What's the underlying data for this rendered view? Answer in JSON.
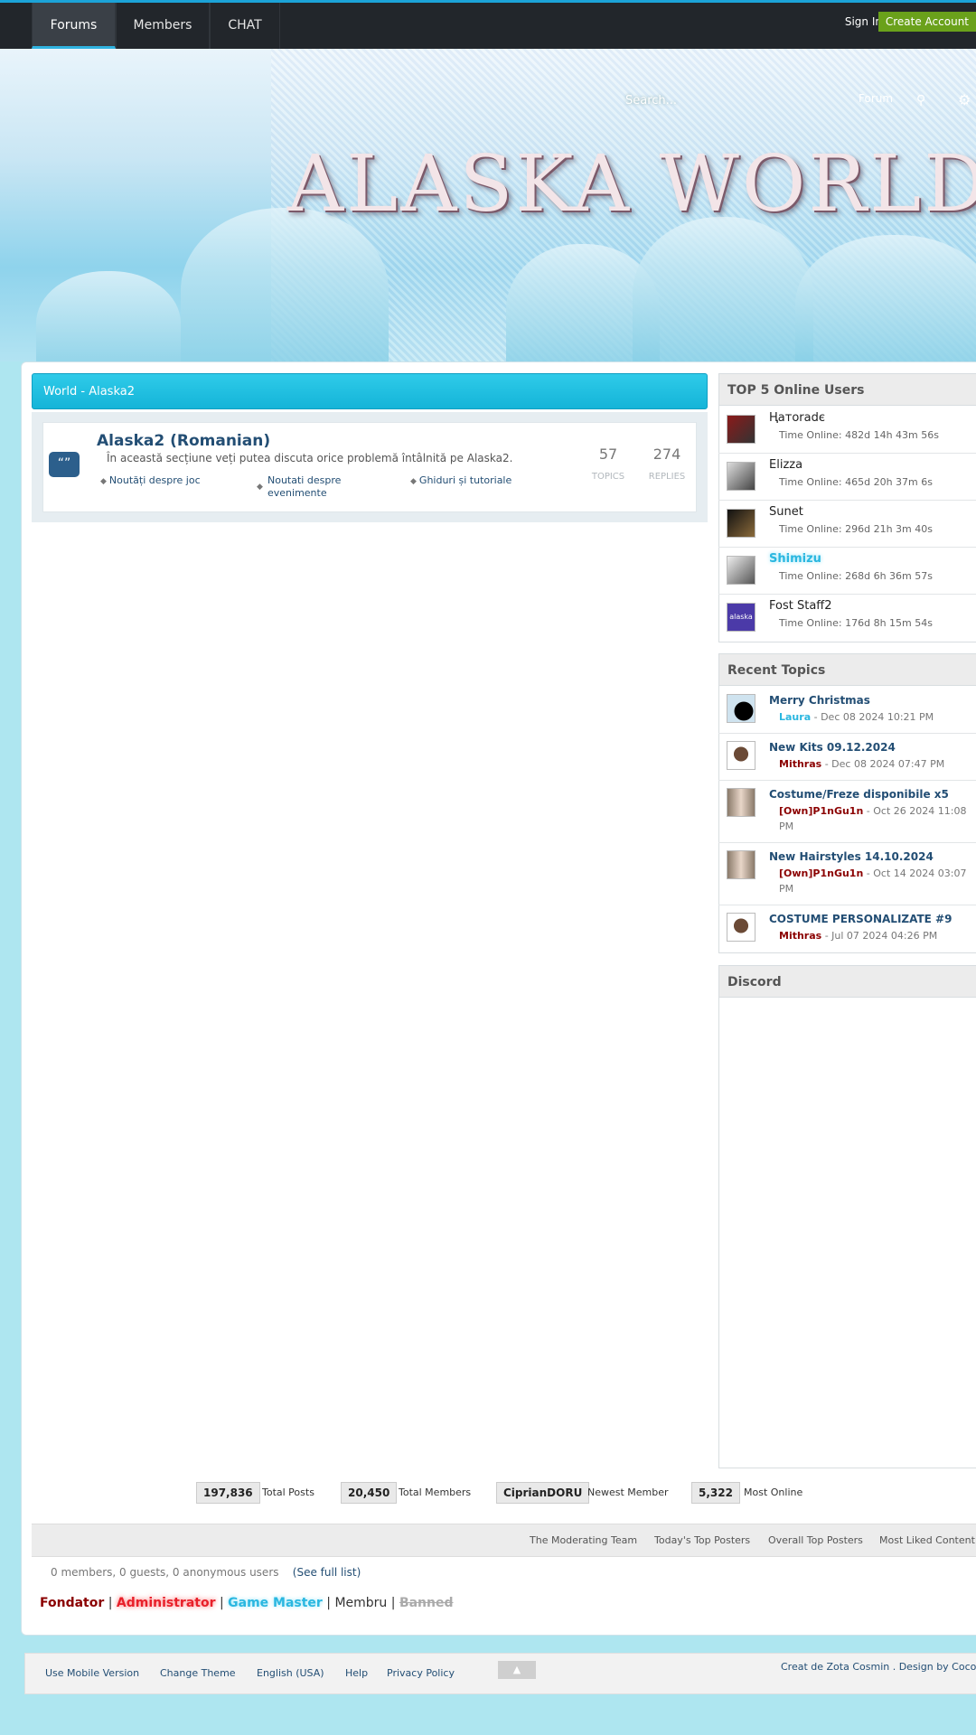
{
  "nav": {
    "tabs": [
      {
        "label": "Forums"
      },
      {
        "label": "Members"
      },
      {
        "label": "CHAT"
      }
    ],
    "sign_in": "Sign In",
    "create_account": "Create Account"
  },
  "banner": {
    "title": "ALASKA WORLD",
    "search_placeholder": "Search...",
    "search_scope": "Forum"
  },
  "category": {
    "title": "World - Alaska2",
    "forum": {
      "title": "Alaska2 (Romanian)",
      "description": "În această secțiune veți putea discuta orice problemă întâlnită pe Alaska2.",
      "subforums": [
        "Noutăți despre joc",
        "Noutati despre\nevenimente",
        "Ghiduri și tutoriale"
      ],
      "topics": "57",
      "topics_label": "TOPICS",
      "replies": "274",
      "replies_label": "REPLIES"
    }
  },
  "top_users": {
    "title": "TOP 5 Online Users",
    "users": [
      {
        "name": "Ңатoradє",
        "time": "Time Online: 482d 14h 43m 56s",
        "color": "#222222"
      },
      {
        "name": "Elizza",
        "time": "Time Online: 465d 20h 37m 6s",
        "color": "#222222"
      },
      {
        "name": "Sunet",
        "time": "Time Online: 296d 21h 3m 40s",
        "color": "#222222"
      },
      {
        "name": "Shimizu",
        "time": "Time Online: 268d 6h 36m 57s",
        "color": "#2ab7e0"
      },
      {
        "name": "Fost Staff2",
        "time": "Time Online: 176d 8h 15m 54s",
        "color": "#222222"
      }
    ]
  },
  "recent_topics": {
    "title": "Recent Topics",
    "items": [
      {
        "title": "Merry Christmas",
        "author": "Laura",
        "author_color": "#2ab7e0",
        "meta": " - Dec 08 2024 10:21 PM"
      },
      {
        "title": "New Kits 09.12.2024",
        "author": "Mithras",
        "author_color": "#8b0000",
        "meta": " - Dec 08 2024 07:47 PM"
      },
      {
        "title": "Costume/Freze disponibile x5",
        "author": "[Own]P1nGu1n",
        "author_color": "#8b0000",
        "meta": " - Oct 26 2024 11:08 PM"
      },
      {
        "title": "New Hairstyles 14.10.2024",
        "author": "[Own]P1nGu1n",
        "author_color": "#8b0000",
        "meta": " - Oct 14 2024 03:07 PM"
      },
      {
        "title": "COSTUME PERSONALIZATE #9",
        "author": "Mithras",
        "author_color": "#8b0000",
        "meta": " - Jul 07 2024 04:26 PM"
      }
    ]
  },
  "discord": {
    "title": "Discord"
  },
  "stats": {
    "total_posts": "197,836",
    "total_posts_label": "Total Posts",
    "total_members": "20,450",
    "total_members_label": "Total Members",
    "newest_member": "CiprianDORU",
    "newest_member_label": "Newest Member",
    "most_online": "5,322",
    "most_online_label": "Most Online"
  },
  "links": [
    "The Moderating Team",
    "Today's Top Posters",
    "Overall Top Posters",
    "Most Liked Content"
  ],
  "online": {
    "text": "0 members, 0 guests, 0 anonymous users",
    "link": "(See full list)"
  },
  "legend": {
    "fondator": "Fondator",
    "administrator": "Administrator",
    "game_master": "Game Master",
    "membru": "Membru",
    "banned": "Banned",
    "sep": "|"
  },
  "footer": {
    "items": [
      "Use Mobile Version",
      "Change Theme",
      "English (USA)",
      "Help",
      "Privacy Policy"
    ],
    "credit": "Creat de Zota Cosmin . Design by Cocolino",
    "top_button": "▲"
  }
}
